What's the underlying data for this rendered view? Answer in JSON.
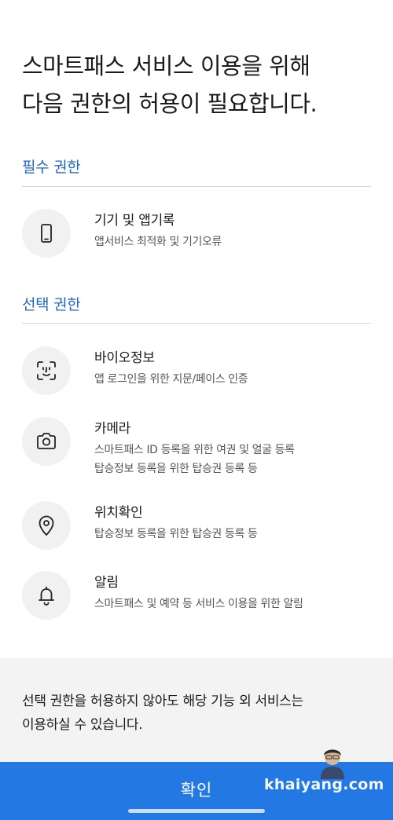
{
  "header": {
    "title_line1": "스마트패스 서비스 이용을 위해",
    "title_line2": "다음 권한의 허용이 필요합니다."
  },
  "required_section": {
    "heading": "필수 권한",
    "items": [
      {
        "icon": "smartphone-icon",
        "title": "기기 및 앱기록",
        "desc_lines": [
          "앱서비스 최적화 및 기기오류"
        ]
      }
    ]
  },
  "optional_section": {
    "heading": "선택 권한",
    "items": [
      {
        "icon": "face-id-icon",
        "title": "바이오정보",
        "desc_lines": [
          "앱 로그인을 위한 지문/페이스 인증"
        ]
      },
      {
        "icon": "camera-icon",
        "title": "카메라",
        "desc_lines": [
          "스마트패스 ID 등록을 위한 여권 및 얼굴 등록",
          "탑승정보 등록을 위한 탑승권 등록 등"
        ]
      },
      {
        "icon": "location-pin-icon",
        "title": "위치확인",
        "desc_lines": [
          "탑승정보 등록을 위한 탑승권 등록 등"
        ]
      },
      {
        "icon": "bell-icon",
        "title": "알림",
        "desc_lines": [
          "스마트패스 및 예약 등 서비스 이용을 위한 알림"
        ]
      }
    ]
  },
  "notice": {
    "line1": "선택 권한을 허용하지 않아도 해당 기능 외 서비스는",
    "line2": "이용하실 수 있습니다."
  },
  "confirm_button": {
    "label": "확인"
  },
  "watermark": {
    "text": "khaiyang.com"
  },
  "colors": {
    "accent": "#1f66c1",
    "button": "#2478e3",
    "notice_bg": "#f3f3f3",
    "icon_bg": "#f1f1f1"
  }
}
